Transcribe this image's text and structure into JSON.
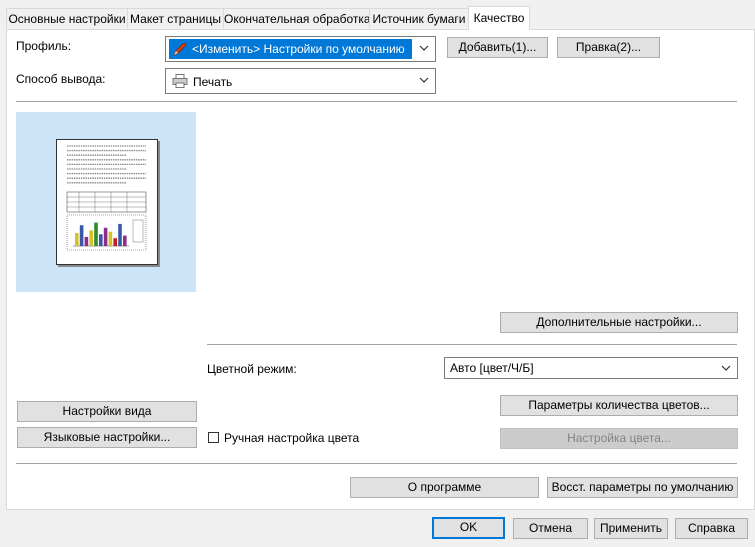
{
  "tabs": [
    "Основные настройки",
    "Макет страницы",
    "Окончательная обработка",
    "Источник бумаги",
    "Качество"
  ],
  "active_tab_index": 4,
  "profile": {
    "label": "Профиль:",
    "value": "<Изменить> Настройки по умолчанию",
    "add_button": "Добавить(1)...",
    "edit_button": "Правка(2)..."
  },
  "output": {
    "label": "Способ вывода:",
    "value": "Печать"
  },
  "advanced_button": "Дополнительные настройки...",
  "color_mode": {
    "label": "Цветной режим:",
    "value": "Авто [цвет/Ч/Б]"
  },
  "color_count_button": "Параметры количества цветов...",
  "manual_color": {
    "label": "Ручная настройка цвета",
    "checked": false
  },
  "color_settings_button": "Настройка цвета...",
  "view_settings_button": "Настройки вида",
  "language_settings_button": "Языковые настройки...",
  "about_button": "О программе",
  "restore_defaults_button": "Восст. параметры по умолчанию",
  "footer": {
    "ok": "OK",
    "cancel": "Отмена",
    "apply": "Применить",
    "help": "Справка"
  },
  "colors": {
    "highlight": "#0078d7",
    "preview_bg": "#cce4f7"
  },
  "preview_chart": {
    "bars": [
      {
        "color": "#d4c22a",
        "value": 0.5
      },
      {
        "color": "#3a56a8",
        "value": 0.8
      },
      {
        "color": "#8c2d8c",
        "value": 0.35
      },
      {
        "color": "#d4c22a",
        "value": 0.6
      },
      {
        "color": "#2c8c2c",
        "value": 0.9
      },
      {
        "color": "#3a56a8",
        "value": 0.45
      },
      {
        "color": "#8c2d8c",
        "value": 0.7
      },
      {
        "color": "#d4c22a",
        "value": 0.55
      },
      {
        "color": "#c02020",
        "value": 0.3
      },
      {
        "color": "#3a56a8",
        "value": 0.85
      },
      {
        "color": "#8c2d8c",
        "value": 0.4
      }
    ]
  }
}
